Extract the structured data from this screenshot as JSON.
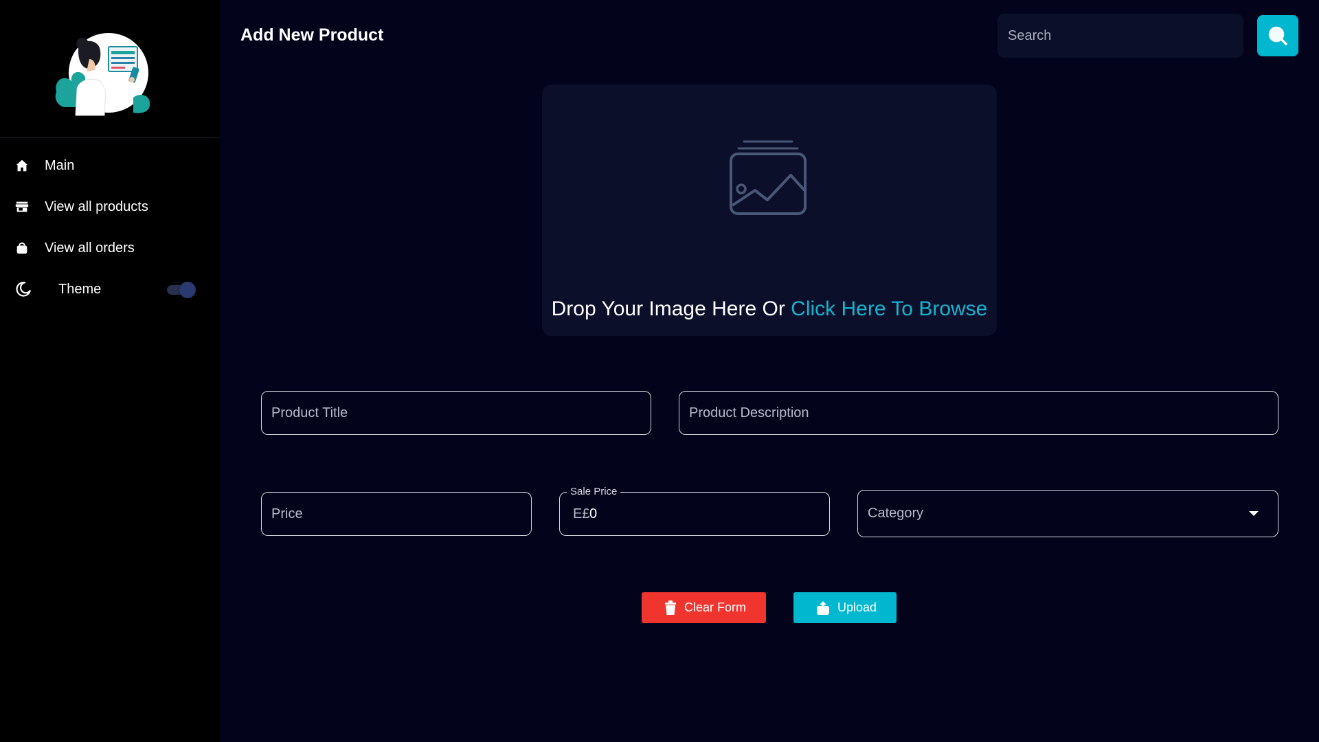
{
  "sidebar": {
    "nav": [
      {
        "label": "Main",
        "icon": "home-icon"
      },
      {
        "label": "View all products",
        "icon": "store-icon"
      },
      {
        "label": "View all orders",
        "icon": "shopping-bag-icon"
      }
    ],
    "theme": {
      "label": "Theme",
      "icon": "moon-icon",
      "enabled": true
    }
  },
  "header": {
    "title": "Add New Product",
    "search": {
      "placeholder": "Search",
      "value": ""
    }
  },
  "dropzone": {
    "icon": "image-placeholder-icon",
    "text": "Drop Your Image Here Or",
    "link": "Click Here To Browse"
  },
  "form": {
    "title": {
      "placeholder": "Product Title",
      "value": ""
    },
    "description": {
      "placeholder": "Product Description",
      "value": ""
    },
    "price": {
      "placeholder": "Price",
      "value": ""
    },
    "sale_price": {
      "label": "Sale Price",
      "prefix": "E£",
      "value": "0"
    },
    "category": {
      "placeholder": "Category",
      "value": ""
    }
  },
  "actions": {
    "clear_label": "Clear Form",
    "upload_label": "Upload"
  },
  "colors": {
    "background": "#03031c",
    "sidebar": "#000000",
    "accent": "#00b7d0",
    "danger": "#f0342e",
    "link": "#16b3cf"
  }
}
